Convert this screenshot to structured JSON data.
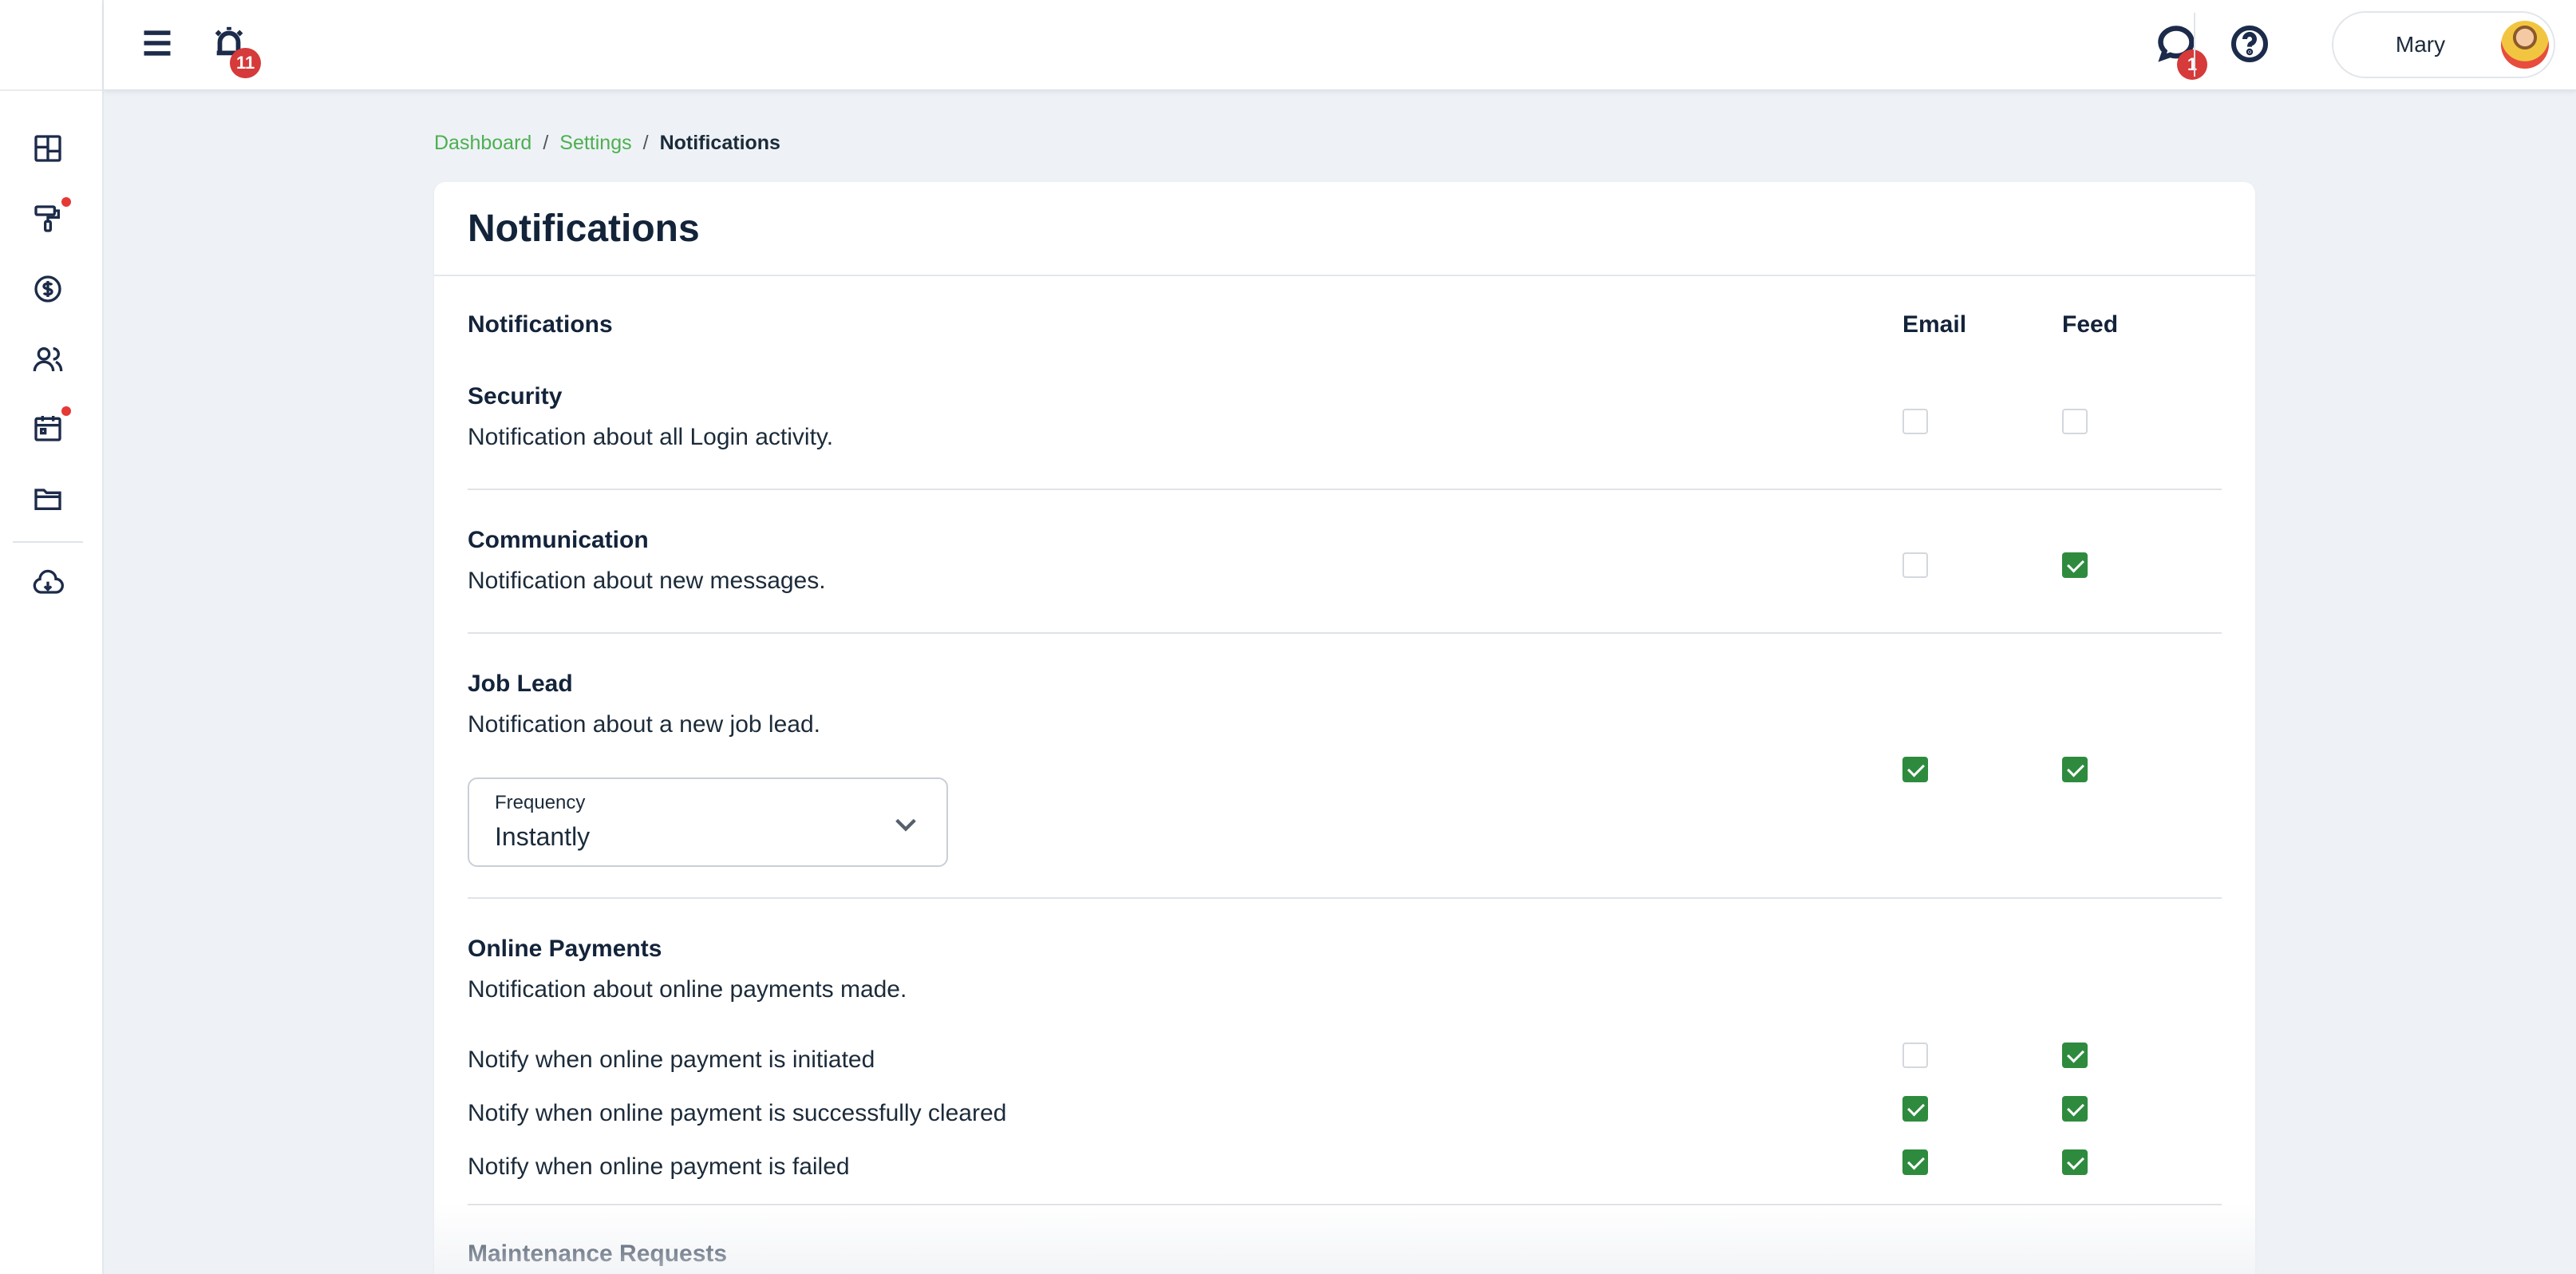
{
  "topbar": {
    "alarm_badge": "11",
    "chat_badge": "1",
    "user_name": "Mary"
  },
  "sidebar": {
    "items": [
      {
        "icon": "dashboard-icon",
        "dot": false
      },
      {
        "icon": "paint-roller-icon",
        "dot": true
      },
      {
        "icon": "dollar-icon",
        "dot": false
      },
      {
        "icon": "users-icon",
        "dot": false
      },
      {
        "icon": "calendar-icon",
        "dot": true
      },
      {
        "icon": "folder-icon",
        "dot": false
      },
      {
        "icon": "cloud-download-icon",
        "dot": false
      }
    ]
  },
  "breadcrumb": {
    "items": [
      "Dashboard",
      "Settings",
      "Notifications"
    ]
  },
  "page": {
    "title": "Notifications"
  },
  "table": {
    "col_notifications": "Notifications",
    "col_email": "Email",
    "col_feed": "Feed"
  },
  "sections": {
    "security": {
      "title": "Security",
      "desc": "Notification about all Login activity.",
      "email": false,
      "feed": false
    },
    "communication": {
      "title": "Communication",
      "desc": "Notification about new messages.",
      "email": false,
      "feed": true
    },
    "job_lead": {
      "title": "Job Lead",
      "desc": "Notification about a new job lead.",
      "email": true,
      "feed": true,
      "frequency_label": "Frequency",
      "frequency_value": "Instantly"
    },
    "online_payments": {
      "title": "Online Payments",
      "desc": "Notification about online payments made.",
      "rows": [
        {
          "label": "Notify when online payment is initiated",
          "email": false,
          "feed": true
        },
        {
          "label": "Notify when online payment is successfully cleared",
          "email": true,
          "feed": true
        },
        {
          "label": "Notify when online payment is failed",
          "email": true,
          "feed": true
        }
      ]
    },
    "maintenance": {
      "title": "Maintenance Requests"
    }
  }
}
